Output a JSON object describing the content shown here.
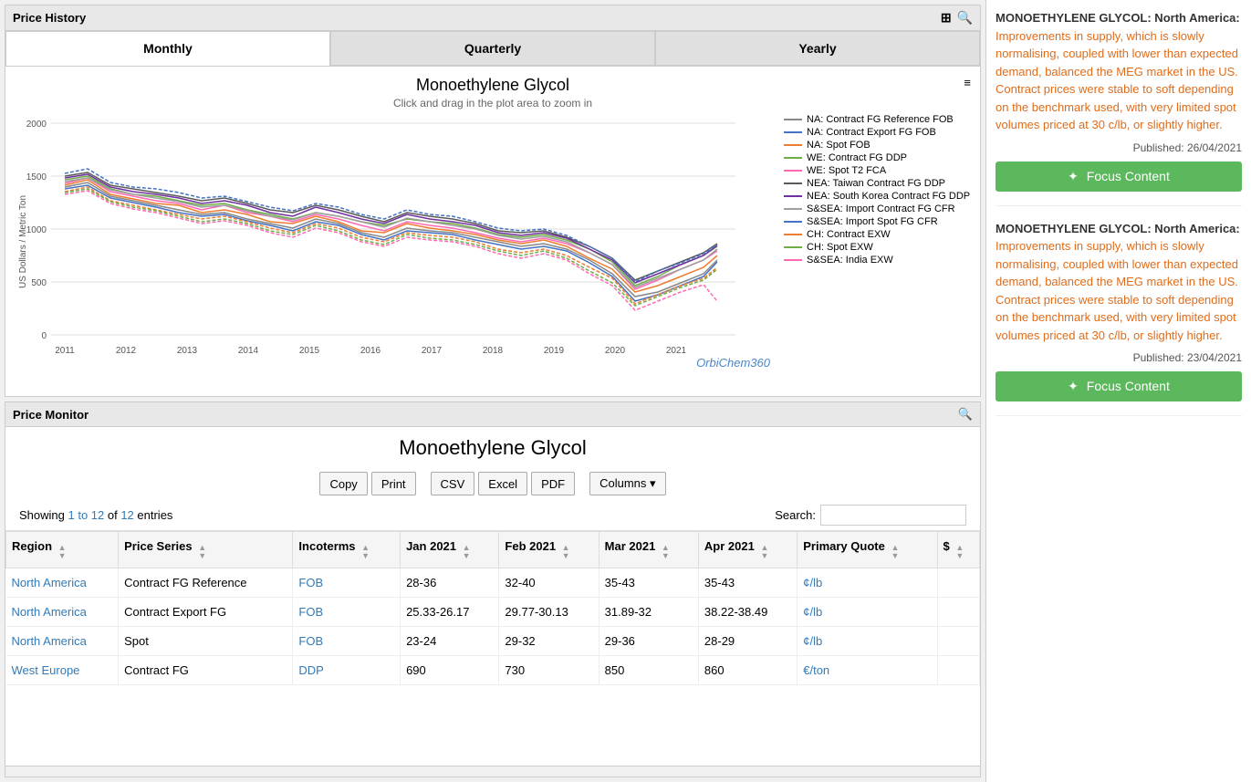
{
  "priceHistory": {
    "title": "Price History",
    "chartTitle": "Monoethylene Glycol",
    "chartSubtitle": "Click and drag in the plot area to zoom in",
    "tabs": [
      {
        "label": "Monthly",
        "active": true
      },
      {
        "label": "Quarterly",
        "active": false
      },
      {
        "label": "Yearly",
        "active": false
      }
    ],
    "watermark": "OrbiChem360",
    "legend": [
      {
        "label": "NA: Contract FG Reference FOB",
        "color": "#888888"
      },
      {
        "label": "NA: Contract Export FG FOB",
        "color": "#4472c4"
      },
      {
        "label": "NA: Spot FOB",
        "color": "#ed7d31"
      },
      {
        "label": "WE: Contract FG DDP",
        "color": "#70ad47"
      },
      {
        "label": "WE: Spot T2 FCA",
        "color": "#ff69b4"
      },
      {
        "label": "NEA: Taiwan Contract FG DDP",
        "color": "#5a5a5a"
      },
      {
        "label": "NEA: South Korea Contract FG DDP",
        "color": "#7030a0"
      },
      {
        "label": "S&SEA: Import Contract FG CFR",
        "color": "#9e9e9e"
      },
      {
        "label": "S&SEA: Import Spot FG CFR",
        "color": "#4472c4"
      },
      {
        "label": "CH: Contract EXW",
        "color": "#ed7d31"
      },
      {
        "label": "CH: Spot EXW",
        "color": "#70ad47"
      },
      {
        "label": "S&SEA: India EXW",
        "color": "#ff69b4"
      }
    ],
    "yAxisLabel": "US Dollars / Metric Ton",
    "yAxis": [
      0,
      500,
      1000,
      1500,
      2000
    ],
    "xAxis": [
      "2011",
      "2012",
      "2013",
      "2014",
      "2015",
      "2016",
      "2017",
      "2018",
      "2019",
      "2020",
      "2021"
    ]
  },
  "priceMonitor": {
    "title": "Price Monitor",
    "chartTitle": "Monoethylene Glycol",
    "toolbar": {
      "copy": "Copy",
      "print": "Print",
      "csv": "CSV",
      "excel": "Excel",
      "pdf": "PDF",
      "columns": "Columns"
    },
    "showingText": "Showing ",
    "showingRange": "1 to 12",
    "showingOf": " of ",
    "showingTotal": "12",
    "showingEntries": " entries",
    "searchLabel": "Search:",
    "columns": [
      "Region",
      "Price Series",
      "Incoterms",
      "Jan 2021",
      "Feb 2021",
      "Mar 2021",
      "Apr 2021",
      "Primary Quote",
      "$"
    ],
    "rows": [
      {
        "region": "North America",
        "priceSeries": "Contract FG Reference",
        "incoterms": "FOB",
        "jan": "28-36",
        "feb": "32-40",
        "mar": "35-43",
        "apr": "35-43",
        "primaryQuote": "¢/lb",
        "unit": ""
      },
      {
        "region": "North America",
        "priceSeries": "Contract Export FG",
        "incoterms": "FOB",
        "jan": "25.33-26.17",
        "feb": "29.77-30.13",
        "mar": "31.89-32",
        "apr": "38.22-38.49",
        "primaryQuote": "¢/lb",
        "unit": ""
      },
      {
        "region": "North America",
        "priceSeries": "Spot",
        "incoterms": "FOB",
        "jan": "23-24",
        "feb": "29-32",
        "mar": "29-36",
        "apr": "28-29",
        "primaryQuote": "¢/lb",
        "unit": ""
      },
      {
        "region": "West Europe",
        "priceSeries": "Contract FG",
        "incoterms": "DDP",
        "jan": "690",
        "feb": "730",
        "mar": "850",
        "apr": "860",
        "primaryQuote": "€/ton",
        "unit": ""
      }
    ]
  },
  "rightPanel": {
    "articles": [
      {
        "text1": "MONOETHYLENE GLYCOL: North America: ",
        "highlight": "Improvements in supply, which is slowly normalising, coupled with lower than expected demand, balanced the MEG market in the US. Contract prices were stable to soft depending on the benchmark used, with very limited spot volumes priced at 30 c/lb, or slightly higher.",
        "text2": "",
        "publishedLabel": "Published: ",
        "publishedDate": "26/04/2021",
        "focusBtn": "Focus Content"
      },
      {
        "text1": "MONOETHYLENE GLYCOL: North America: ",
        "highlight": "Improvements in supply, which is slowly normalising, coupled with lower than expected demand, balanced the MEG market in the US. Contract prices were stable to soft depending on the benchmark used, with very limited spot volumes priced at 30 c/lb, or slightly higher.",
        "text2": "",
        "publishedLabel": "Published: ",
        "publishedDate": "23/04/2021",
        "focusBtn": "Focus Content"
      }
    ]
  }
}
